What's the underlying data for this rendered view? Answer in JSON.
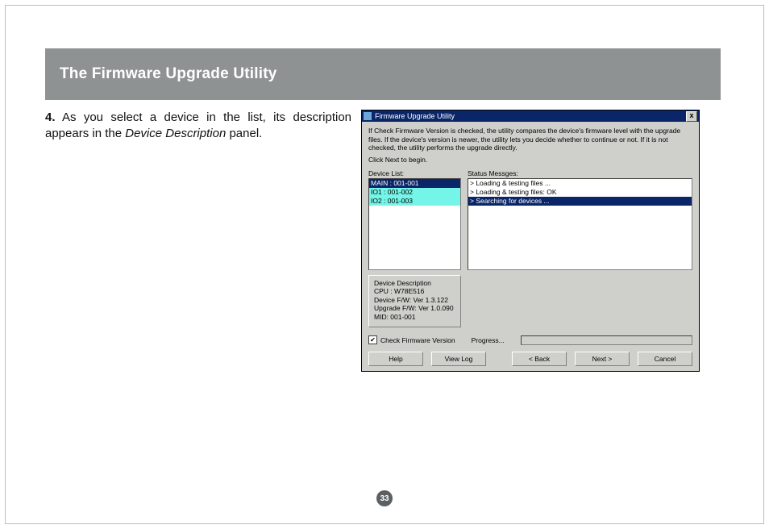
{
  "header": {
    "title": "The Firmware Upgrade Utility"
  },
  "instruction": {
    "number": "4.",
    "text_before": "As you select a device in the list, its descrip­tion appears in the ",
    "italic": "Device Description",
    "text_after": " panel."
  },
  "dialog": {
    "title": "Firmware Upgrade Utility",
    "close_glyph": "x",
    "note_line1": "If Check Firmware Version is checked, the utility compares the device's firmware level with the upgrade files. If the device's version is newer, the utility lets you decide whether to continue or not. If it is not checked, the utility performs the upgrade directly.",
    "note_line2": "Click Next to begin.",
    "device_list_label": "Device List:",
    "status_label": "Status Messges:",
    "devices": [
      {
        "text": "MAIN : 001-001",
        "state": "selected"
      },
      {
        "text": "IO1 : 001-002",
        "state": "highlight"
      },
      {
        "text": "IO2 : 001-003",
        "state": "highlight"
      }
    ],
    "messages": [
      {
        "text": "> Loading & testing files ...",
        "state": "normal"
      },
      {
        "text": "> Loading & testing files: OK",
        "state": "normal"
      },
      {
        "text": "> Searching for devices ...",
        "state": "selected"
      }
    ],
    "description": {
      "heading": "Device Description",
      "lines": [
        "CPU : W78E516",
        "Device F/W: Ver 1.3.122",
        "Upgrade F/W: Ver 1.0.090",
        "MID: 001-001"
      ]
    },
    "check_label": "Check Firmware Version",
    "check_mark": "✔",
    "progress_label": "Progress...",
    "buttons": {
      "help": "Help",
      "viewlog": "View Log",
      "back": "< Back",
      "next": "Next >",
      "cancel": "Cancel"
    }
  },
  "page_number": "33"
}
